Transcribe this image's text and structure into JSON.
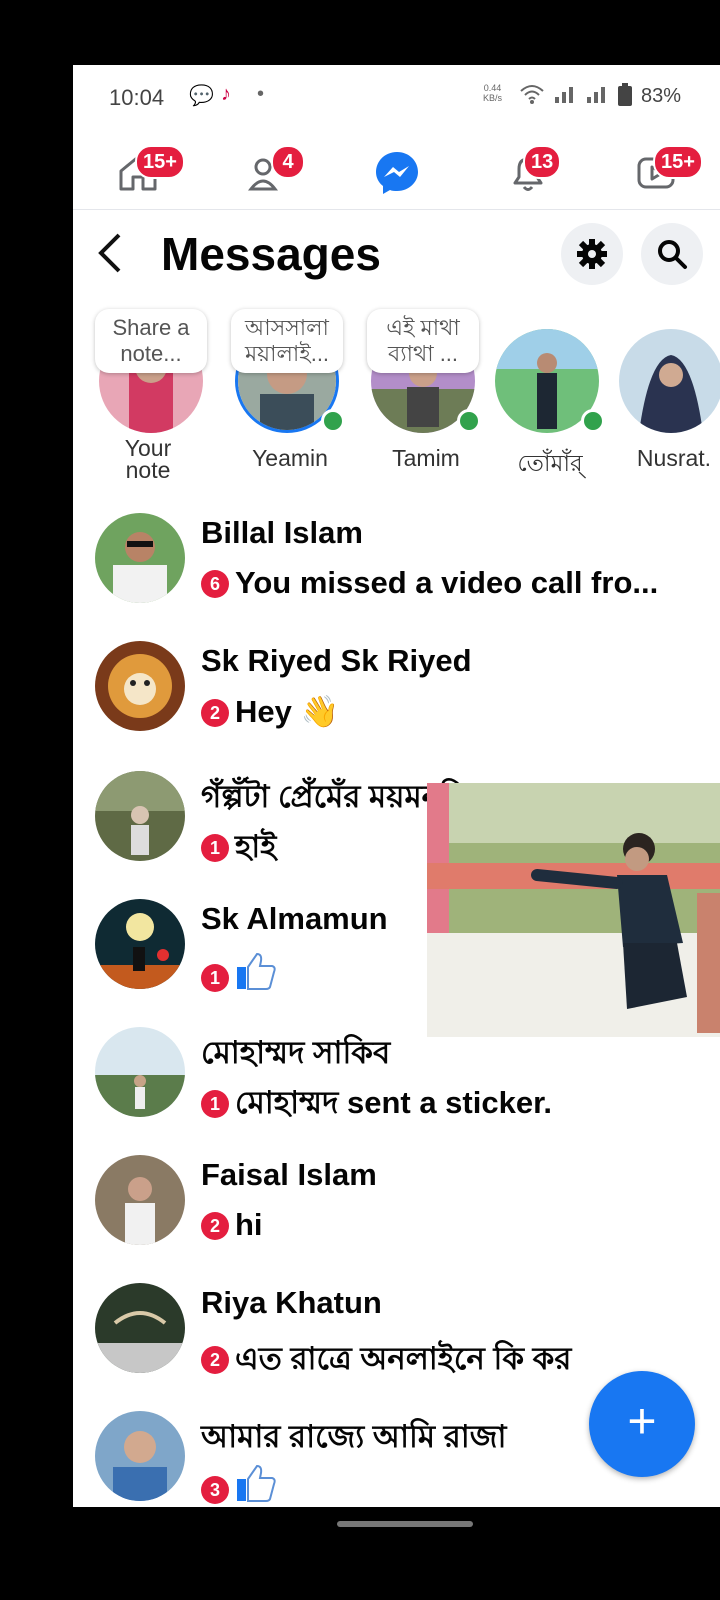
{
  "status": {
    "time": "10:04",
    "speed_value": "0.44",
    "speed_unit": "KB/s",
    "battery": "83%"
  },
  "nav": {
    "home_badge": "15+",
    "friends_badge": "4",
    "notifications_badge": "13",
    "video_badge": "15+"
  },
  "header": {
    "title": "Messages"
  },
  "stories": [
    {
      "name": "Your\nnote",
      "note": "Share a note..."
    },
    {
      "name": "Yeamin",
      "note": "আসসালা ময়ালাই..."
    },
    {
      "name": "Tamim",
      "note": "এই মাথা ব্যাথা ..."
    },
    {
      "name": "তোঁমাঁর্"
    },
    {
      "name": "Nusrat."
    }
  ],
  "chats": [
    {
      "name": "Billal Islam",
      "count": "6",
      "last": "You missed a video call fro..."
    },
    {
      "name": "Sk Riyed Sk Riyed",
      "count": "2",
      "last": "Hey 👋"
    },
    {
      "name": "গঁল্পঁটা প্রেঁমেঁর ময়মনসিংহ",
      "count": "1",
      "last": "হাই"
    },
    {
      "name": "Sk Almamun",
      "count": "1",
      "last": ""
    },
    {
      "name": "মোহাম্মদ সাকিব",
      "count": "1",
      "last": "মোহাম্মদ sent a sticker."
    },
    {
      "name": "Faisal Islam",
      "count": "2",
      "last": "hi"
    },
    {
      "name": "Riya Khatun",
      "count": "2",
      "last": "এত রাত্রে অনলাইনে কি কর"
    },
    {
      "name": "আমার রাজ্যে আমি রাজা",
      "count": "3",
      "last": ""
    }
  ],
  "fab_label": "+"
}
